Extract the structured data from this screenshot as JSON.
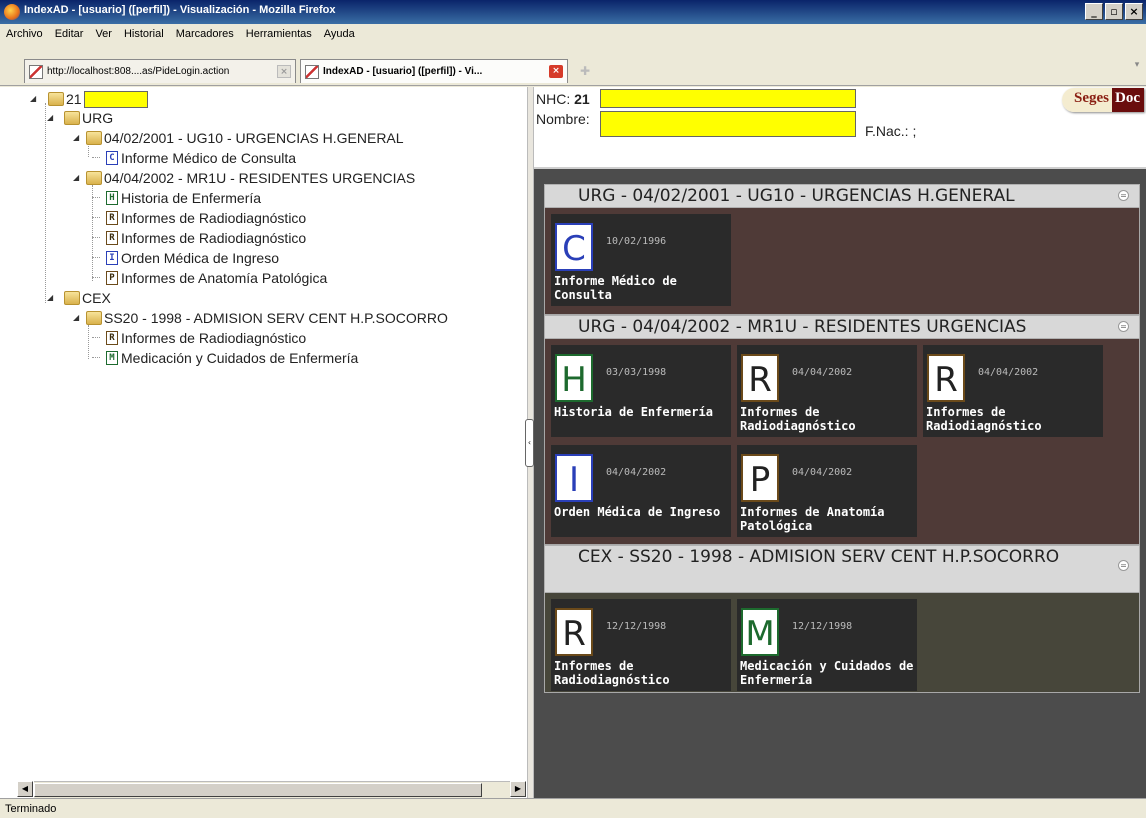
{
  "window": {
    "title": "IndexAD - [usuario] ([perfil]) - Visualización - Mozilla Firefox"
  },
  "menu": [
    "Archivo",
    "Editar",
    "Ver",
    "Historial",
    "Marcadores",
    "Herramientas",
    "Ayuda"
  ],
  "tabs": [
    {
      "label": "http://localhost:808....as/PideLogin.action"
    },
    {
      "label": "IndexAD - [usuario] ([perfil]) - Vi..."
    }
  ],
  "tree": {
    "root": "21",
    "groups": [
      {
        "label": "URG"
      },
      {
        "label": "04/02/2001 - UG10 - URGENCIAS H.GENERAL"
      },
      {
        "label": "04/04/2002 - MR1U - RESIDENTES URGENCIAS"
      },
      {
        "label": "CEX"
      },
      {
        "label": "SS20 - 1998 - ADMISION SERV CENT H.P.SOCORRO"
      }
    ],
    "items": [
      {
        "letter": "C",
        "label": "Informe Médico de Consulta"
      },
      {
        "letter": "H",
        "label": "Historia de Enfermería"
      },
      {
        "letter": "R",
        "label": "Informes de Radiodiagnóstico"
      },
      {
        "letter": "R",
        "label": "Informes de Radiodiagnóstico"
      },
      {
        "letter": "I",
        "label": "Orden Médica de Ingreso"
      },
      {
        "letter": "P",
        "label": "Informes de Anatomía Patológica"
      },
      {
        "letter": "R",
        "label": "Informes de Radiodiagnóstico"
      },
      {
        "letter": "M",
        "label": "Medicación y Cuidados de Enfermería"
      }
    ]
  },
  "patient": {
    "nhc_label": "NHC:",
    "nhc_value": "21",
    "nombre_label": "Nombre:",
    "fnac_label": "F.Nac.: ;",
    "logo_a": "Seges",
    "logo_b": "Doc"
  },
  "episodes": [
    {
      "header": "URG - 04/02/2001 - UG10 - URGENCIAS H.GENERAL",
      "bg": "#4f3a37",
      "cards": [
        {
          "letter": "C",
          "date": "10/02/1996",
          "title": "Informe Médico de Consulta"
        }
      ]
    },
    {
      "header": "URG - 04/04/2002 - MR1U - RESIDENTES URGENCIAS",
      "bg": "#4f3a37",
      "cards": [
        {
          "letter": "H",
          "date": "03/03/1998",
          "title": "Historia de Enfermería"
        },
        {
          "letter": "R",
          "date": "04/04/2002",
          "title": "Informes de Radiodiagnóstico"
        },
        {
          "letter": "R",
          "date": "04/04/2002",
          "title": "Informes de Radiodiagnóstico"
        },
        {
          "letter": "I",
          "date": "04/04/2002",
          "title": "Orden Médica de Ingreso"
        },
        {
          "letter": "P",
          "date": "04/04/2002",
          "title": "Informes de Anatomía Patológica"
        }
      ]
    },
    {
      "header": "CEX - SS20 - 1998 - ADMISION SERV CENT H.P.SOCORRO",
      "bg": "#47463a",
      "cards": [
        {
          "letter": "R",
          "date": "12/12/1998",
          "title": "Informes de Radiodiagnóstico"
        },
        {
          "letter": "M",
          "date": "12/12/1998",
          "title": "Medicación y Cuidados de Enfermería"
        }
      ]
    }
  ],
  "status": "Terminado"
}
